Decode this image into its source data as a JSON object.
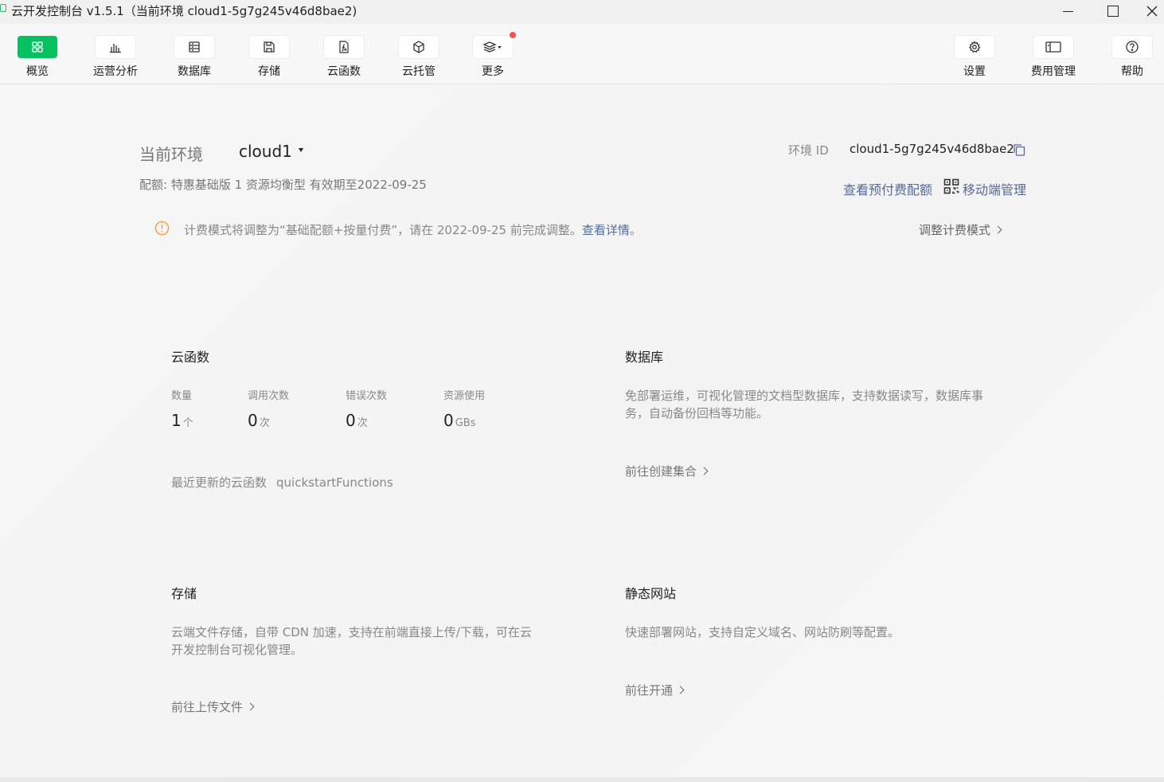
{
  "window": {
    "title": "云开发控制台 v1.5.1（当前环境 cloud1-5g7g245v46d8bae2)"
  },
  "toolbar": {
    "left": [
      {
        "label": "概览",
        "icon": "grid-icon",
        "active": true
      },
      {
        "label": "运营分析",
        "icon": "bar-chart-icon"
      },
      {
        "label": "数据库",
        "icon": "database-icon"
      },
      {
        "label": "存储",
        "icon": "floppy-icon"
      },
      {
        "label": "云函数",
        "icon": "function-icon"
      },
      {
        "label": "云托管",
        "icon": "cube-icon"
      },
      {
        "label": "更多",
        "icon": "layers-icon",
        "has_dropdown": true,
        "badge": true
      }
    ],
    "right": [
      {
        "label": "设置",
        "icon": "gear-icon"
      },
      {
        "label": "费用管理",
        "icon": "billing-icon"
      },
      {
        "label": "帮助",
        "icon": "help-icon"
      }
    ]
  },
  "env": {
    "label": "当前环境",
    "name": "cloud1",
    "quota": "配额: 特惠基础版 1 资源均衡型 有效期至2022-09-25",
    "id_label": "环境 ID",
    "id_value": "cloud1-5g7g245v46d8bae2",
    "link_prepaid": "查看预付费配额",
    "link_mobile": "移动端管理"
  },
  "notice": {
    "text": "计费模式将调整为“基础配额+按量付费”，请在 2022-09-25 前完成调整。",
    "link": "查看详情",
    "link_suffix": "。",
    "action": "调整计费模式"
  },
  "cards": {
    "functions": {
      "title": "云函数",
      "stats": [
        {
          "label": "数量",
          "value": "1",
          "unit": "个"
        },
        {
          "label": "调用次数",
          "value": "0",
          "unit": "次"
        },
        {
          "label": "错误次数",
          "value": "0",
          "unit": "次"
        },
        {
          "label": "资源使用",
          "value": "0",
          "unit": "GBs"
        }
      ],
      "recent_label": "最近更新的云函数",
      "recent_value": "quickstartFunctions"
    },
    "database": {
      "title": "数据库",
      "desc": "免部署运维，可视化管理的文档型数据库，支持数据读写，数据库事务，自动备份回档等功能。",
      "link": "前往创建集合"
    },
    "storage": {
      "title": "存储",
      "desc": "云端文件存储，自带 CDN 加速，支持在前端直接上传/下载，可在云开发控制台可视化管理。",
      "link": "前往上传文件"
    },
    "hosting": {
      "title": "静态网站",
      "desc": "快速部署网站，支持自定义域名、网站防刷等配置。",
      "link": "前往开通"
    }
  },
  "colors": {
    "accent_green": "#07c160",
    "link_blue": "#576b95",
    "warning_orange": "#fa9d3b",
    "badge_red": "#fa5151"
  }
}
